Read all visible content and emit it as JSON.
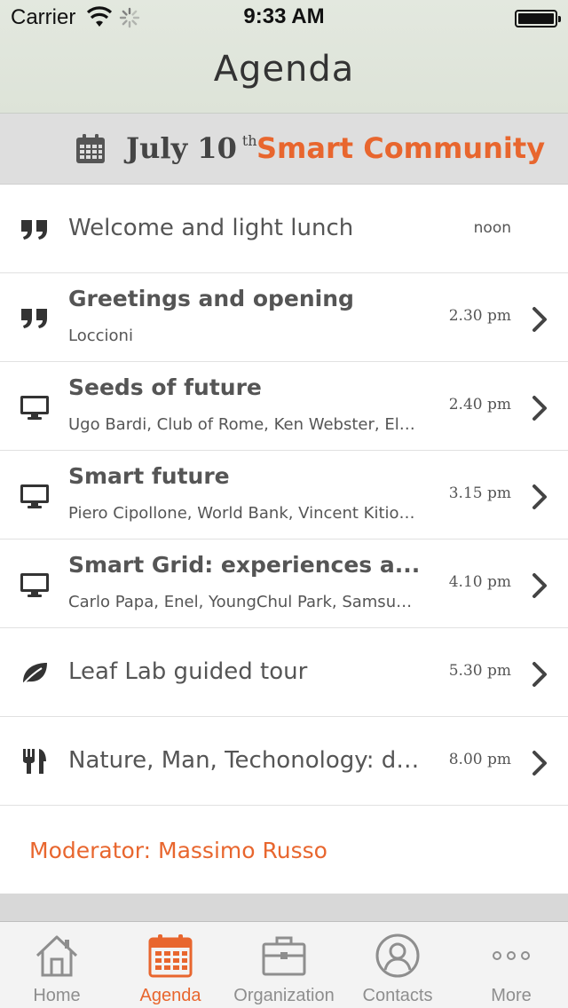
{
  "status_bar": {
    "carrier": "Carrier",
    "time": "9:33 AM"
  },
  "nav": {
    "title": "Agenda"
  },
  "section": {
    "date_day": "July 10",
    "date_suffix": "th",
    "event_name": "Smart Community",
    "icon": "calendar-icon"
  },
  "agenda_items": [
    {
      "icon": "quote-icon",
      "title": "Welcome and light lunch",
      "subtitle": "",
      "time": "noon",
      "has_chevron": false
    },
    {
      "icon": "quote-icon",
      "title": "Greetings and opening",
      "subtitle": "Loccioni",
      "time": "2.30 pm",
      "has_chevron": true
    },
    {
      "icon": "monitor-icon",
      "title": "Seeds of future",
      "subtitle": "Ugo Bardi, Club of Rome, Ken Webster, Ell…",
      "time": "2.40 pm",
      "has_chevron": true
    },
    {
      "icon": "monitor-icon",
      "title": "Smart future",
      "subtitle": "Piero Cipollone, World Bank, Vincent Kitio, U…",
      "time": "3.15 pm",
      "has_chevron": true
    },
    {
      "icon": "monitor-icon",
      "title": "Smart Grid: experiences a...",
      "subtitle": "Carlo Papa, Enel, YoungChul Park, Samsung S…",
      "time": "4.10 pm",
      "has_chevron": true
    },
    {
      "icon": "leaf-icon",
      "title": "Leaf Lab guided tour",
      "subtitle": "",
      "time": "5.30 pm",
      "has_chevron": true
    },
    {
      "icon": "fork-knife-icon",
      "title": "Nature, Man, Techonology: dinn…",
      "subtitle": "",
      "time": "8.00 pm",
      "has_chevron": true
    }
  ],
  "moderator": "Moderator: Massimo Russo",
  "tabs": [
    {
      "label": "Home",
      "icon": "home-icon",
      "active": false
    },
    {
      "label": "Agenda",
      "icon": "calendar-icon",
      "active": true
    },
    {
      "label": "Organization",
      "icon": "briefcase-icon",
      "active": false
    },
    {
      "label": "Contacts",
      "icon": "contact-icon",
      "active": false
    },
    {
      "label": "More",
      "icon": "more-dots-icon",
      "active": false
    }
  ],
  "colors": {
    "accent": "#e8662e",
    "header_bg": "#dedede",
    "nav_bg": "#e0e6dc",
    "tab_inactive": "#8e8e8e"
  }
}
